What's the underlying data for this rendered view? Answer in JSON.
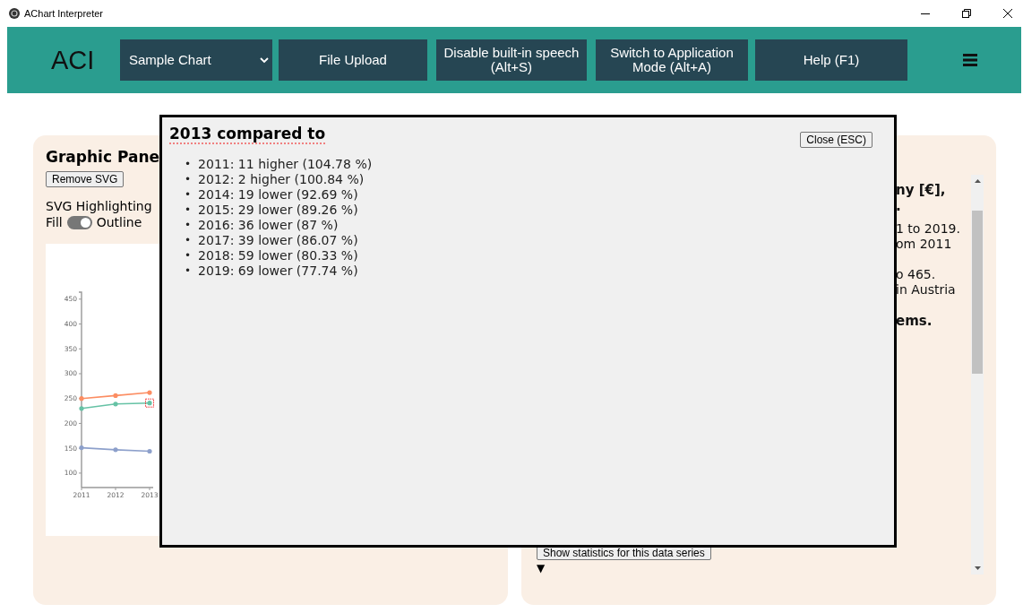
{
  "window": {
    "title": "AChart Interpreter"
  },
  "header": {
    "logo": "ACI",
    "chart_select": {
      "value": "Sample Chart"
    },
    "buttons": [
      {
        "label": "File Upload"
      },
      {
        "label": "Disable built-in speech (Alt+S)"
      },
      {
        "label": "Switch to Application Mode (Alt+A)"
      },
      {
        "label": "Help (F1)"
      }
    ]
  },
  "left_panel": {
    "title": "Graphic Pane",
    "remove_button": "Remove SVG",
    "highlight_label": "SVG Highlighting",
    "toggle": {
      "left_label": "Fill",
      "right_label": "Outline",
      "on": true
    },
    "chart": {
      "chart_data": {
        "type": "line",
        "categories": [
          "2011",
          "2012",
          "2013"
        ],
        "ylim": [
          71,
          464
        ],
        "yticks": [
          100,
          150,
          200,
          250,
          300,
          350,
          400,
          450
        ],
        "series": [
          {
            "color": "#fc8d62",
            "values": [
              250,
              256,
              262
            ]
          },
          {
            "color": "#66c2a5",
            "values": [
              230,
              239,
              241
            ]
          },
          {
            "color": "#8da0cb",
            "values": [
              151,
              147,
              144
            ]
          }
        ]
      },
      "highlighted": [
        [
          false,
          false,
          false
        ],
        [
          false,
          false,
          true
        ],
        [
          false,
          false,
          false
        ]
      ]
    }
  },
  "right_panel": {
    "paragraphs": [
      {
        "kind": "heading",
        "lines": [
          "ny [€],",
          "."
        ]
      },
      {
        "kind": "text",
        "lines": [
          "1 to 2019.",
          "om 2011"
        ]
      },
      {
        "kind": "text",
        "lines": [
          "o 465.",
          "in Austria"
        ]
      },
      {
        "kind": "heading",
        "lines": [
          "ems."
        ]
      }
    ],
    "stats_button": "Show statistics for this data series",
    "expand_marker": "▼"
  },
  "dialog": {
    "title": "2013 compared to",
    "close_button": "Close (ESC)",
    "marker": "•",
    "items": [
      "2011: 11 higher (104.78 %)",
      "2012: 2 higher (100.84 %)",
      "2014: 19 lower (92.69 %)",
      "2015: 29 lower (89.26 %)",
      "2016: 36 lower (87 %)",
      "2017: 39 lower (86.07 %)",
      "2018: 59 lower (80.33 %)",
      "2019: 69 lower (77.74 %)"
    ]
  }
}
